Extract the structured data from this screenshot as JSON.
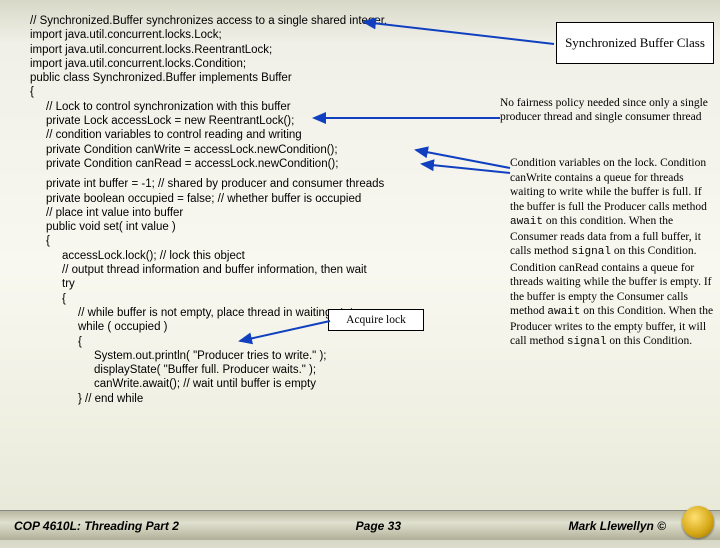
{
  "title_box": "Synchronized Buffer Class",
  "code": {
    "l0": "// Synchronized.Buffer synchronizes access to a single shared integer.",
    "l1": "import java.util.concurrent.locks.Lock;",
    "l2": "import java.util.concurrent.locks.ReentrantLock;",
    "l3": "import java.util.concurrent.locks.Condition;",
    "l4": "public class Synchronized.Buffer implements Buffer",
    "l5": "{",
    "l6": "// Lock to control synchronization with this buffer",
    "l7": "private Lock accessLock = new ReentrantLock();",
    "l8": "// condition variables to control reading and writing",
    "l9": "private Condition canWrite = accessLock.newCondition();",
    "l10": "private Condition canRead = accessLock.newCondition();",
    "l11": "private int buffer = -1; // shared by producer and consumer threads",
    "l12": "private boolean occupied = false; // whether buffer is occupied",
    "l13": "// place int value into buffer",
    "l14": "public void set( int value )",
    "l15": "{",
    "l16": "accessLock.lock(); // lock this object",
    "l17": "// output thread information and buffer information, then wait",
    "l18": "try",
    "l19": "{",
    "l20": "// while buffer is not empty, place thread in waiting state",
    "l21": "while ( occupied )",
    "l22": "{",
    "l23": "System.out.println( \"Producer tries to write.\" );",
    "l24": "displayState( \"Buffer full. Producer waits.\" );",
    "l25": "canWrite.await(); // wait until buffer is empty",
    "l26": "} // end while"
  },
  "callouts": {
    "fairness": "No fairness policy needed since only a single producer thread and single consumer thread",
    "cond": {
      "p1": "Condition variables on the lock. Condition canWrite contains a queue for threads waiting to write while the buffer is full.  If the buffer is full the Producer calls method ",
      "aw1": "await",
      "p2": " on this condition. When the Consumer reads data from a full buffer, it calls method ",
      "sg1": "signal",
      "p3": " on this Condition.",
      "p4": "Condition canRead contains a queue for threads waiting while the buffer is empty.  If the buffer is empty the Consumer calls method ",
      "aw2": "await",
      "p5": " on this Condition. When the Producer writes to the empty buffer, it will call method ",
      "sg2": "signal",
      "p6": " on this Condition."
    }
  },
  "acquire_box": "Acquire lock",
  "footer": {
    "course": "COP 4610L: Threading Part 2",
    "page": "Page 33",
    "author": "Mark Llewellyn ©"
  }
}
